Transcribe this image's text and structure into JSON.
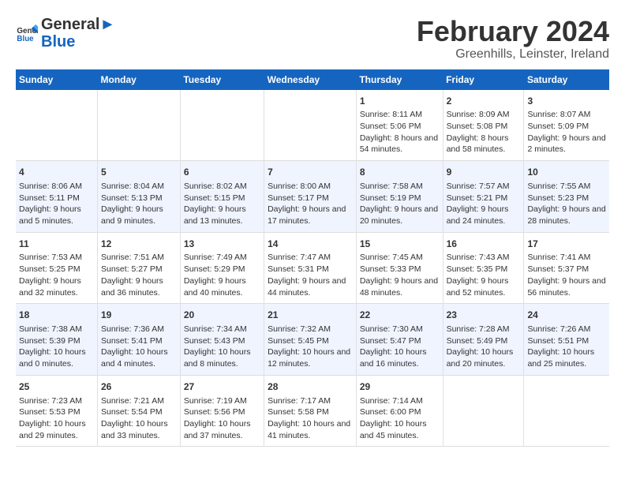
{
  "header": {
    "logo_general": "General",
    "logo_blue": "Blue",
    "title": "February 2024",
    "subtitle": "Greenhills, Leinster, Ireland"
  },
  "calendar": {
    "days_of_week": [
      "Sunday",
      "Monday",
      "Tuesday",
      "Wednesday",
      "Thursday",
      "Friday",
      "Saturday"
    ],
    "weeks": [
      {
        "group": 1,
        "days": [
          {
            "number": "",
            "info": ""
          },
          {
            "number": "",
            "info": ""
          },
          {
            "number": "",
            "info": ""
          },
          {
            "number": "",
            "info": ""
          },
          {
            "number": "1",
            "info": "Sunrise: 8:11 AM\nSunset: 5:06 PM\nDaylight: 8 hours and 54 minutes."
          },
          {
            "number": "2",
            "info": "Sunrise: 8:09 AM\nSunset: 5:08 PM\nDaylight: 8 hours and 58 minutes."
          },
          {
            "number": "3",
            "info": "Sunrise: 8:07 AM\nSunset: 5:09 PM\nDaylight: 9 hours and 2 minutes."
          }
        ]
      },
      {
        "group": 2,
        "days": [
          {
            "number": "4",
            "info": "Sunrise: 8:06 AM\nSunset: 5:11 PM\nDaylight: 9 hours and 5 minutes."
          },
          {
            "number": "5",
            "info": "Sunrise: 8:04 AM\nSunset: 5:13 PM\nDaylight: 9 hours and 9 minutes."
          },
          {
            "number": "6",
            "info": "Sunrise: 8:02 AM\nSunset: 5:15 PM\nDaylight: 9 hours and 13 minutes."
          },
          {
            "number": "7",
            "info": "Sunrise: 8:00 AM\nSunset: 5:17 PM\nDaylight: 9 hours and 17 minutes."
          },
          {
            "number": "8",
            "info": "Sunrise: 7:58 AM\nSunset: 5:19 PM\nDaylight: 9 hours and 20 minutes."
          },
          {
            "number": "9",
            "info": "Sunrise: 7:57 AM\nSunset: 5:21 PM\nDaylight: 9 hours and 24 minutes."
          },
          {
            "number": "10",
            "info": "Sunrise: 7:55 AM\nSunset: 5:23 PM\nDaylight: 9 hours and 28 minutes."
          }
        ]
      },
      {
        "group": 3,
        "days": [
          {
            "number": "11",
            "info": "Sunrise: 7:53 AM\nSunset: 5:25 PM\nDaylight: 9 hours and 32 minutes."
          },
          {
            "number": "12",
            "info": "Sunrise: 7:51 AM\nSunset: 5:27 PM\nDaylight: 9 hours and 36 minutes."
          },
          {
            "number": "13",
            "info": "Sunrise: 7:49 AM\nSunset: 5:29 PM\nDaylight: 9 hours and 40 minutes."
          },
          {
            "number": "14",
            "info": "Sunrise: 7:47 AM\nSunset: 5:31 PM\nDaylight: 9 hours and 44 minutes."
          },
          {
            "number": "15",
            "info": "Sunrise: 7:45 AM\nSunset: 5:33 PM\nDaylight: 9 hours and 48 minutes."
          },
          {
            "number": "16",
            "info": "Sunrise: 7:43 AM\nSunset: 5:35 PM\nDaylight: 9 hours and 52 minutes."
          },
          {
            "number": "17",
            "info": "Sunrise: 7:41 AM\nSunset: 5:37 PM\nDaylight: 9 hours and 56 minutes."
          }
        ]
      },
      {
        "group": 4,
        "days": [
          {
            "number": "18",
            "info": "Sunrise: 7:38 AM\nSunset: 5:39 PM\nDaylight: 10 hours and 0 minutes."
          },
          {
            "number": "19",
            "info": "Sunrise: 7:36 AM\nSunset: 5:41 PM\nDaylight: 10 hours and 4 minutes."
          },
          {
            "number": "20",
            "info": "Sunrise: 7:34 AM\nSunset: 5:43 PM\nDaylight: 10 hours and 8 minutes."
          },
          {
            "number": "21",
            "info": "Sunrise: 7:32 AM\nSunset: 5:45 PM\nDaylight: 10 hours and 12 minutes."
          },
          {
            "number": "22",
            "info": "Sunrise: 7:30 AM\nSunset: 5:47 PM\nDaylight: 10 hours and 16 minutes."
          },
          {
            "number": "23",
            "info": "Sunrise: 7:28 AM\nSunset: 5:49 PM\nDaylight: 10 hours and 20 minutes."
          },
          {
            "number": "24",
            "info": "Sunrise: 7:26 AM\nSunset: 5:51 PM\nDaylight: 10 hours and 25 minutes."
          }
        ]
      },
      {
        "group": 5,
        "days": [
          {
            "number": "25",
            "info": "Sunrise: 7:23 AM\nSunset: 5:53 PM\nDaylight: 10 hours and 29 minutes."
          },
          {
            "number": "26",
            "info": "Sunrise: 7:21 AM\nSunset: 5:54 PM\nDaylight: 10 hours and 33 minutes."
          },
          {
            "number": "27",
            "info": "Sunrise: 7:19 AM\nSunset: 5:56 PM\nDaylight: 10 hours and 37 minutes."
          },
          {
            "number": "28",
            "info": "Sunrise: 7:17 AM\nSunset: 5:58 PM\nDaylight: 10 hours and 41 minutes."
          },
          {
            "number": "29",
            "info": "Sunrise: 7:14 AM\nSunset: 6:00 PM\nDaylight: 10 hours and 45 minutes."
          },
          {
            "number": "",
            "info": ""
          },
          {
            "number": "",
            "info": ""
          }
        ]
      }
    ]
  }
}
